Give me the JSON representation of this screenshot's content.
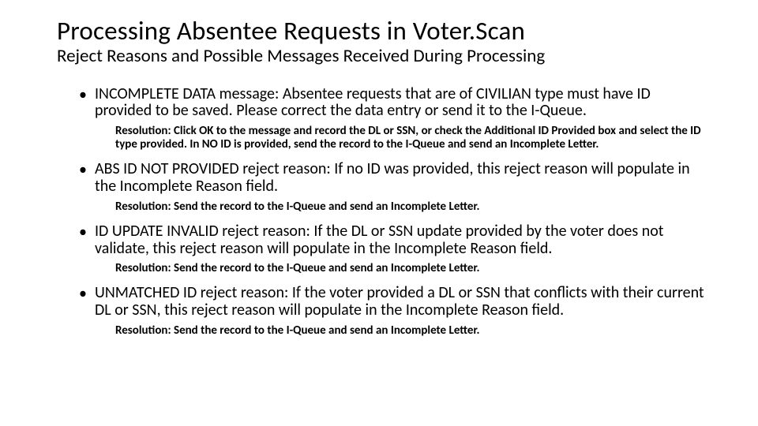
{
  "title": "Processing Absentee Requests in Voter.Scan",
  "subtitle": "Reject Reasons and Possible Messages Received During Processing",
  "items": [
    {
      "text": "INCOMPLETE DATA message: Absentee requests that are of CIVILIAN type must have ID provided to be saved.  Please correct the data entry or send it to the I-Queue.",
      "resolution": "Resolution: Click OK to the message and record the DL or SSN, or check the Additional ID Provided box and select the ID type provided. In NO ID is provided, send the record to the I-Queue and send an Incomplete Letter."
    },
    {
      "text": "ABS ID NOT PROVIDED reject reason: If no ID was provided, this reject reason will populate in the Incomplete Reason field.",
      "resolution": "Resolution: Send the record to the I-Queue and send an Incomplete Letter."
    },
    {
      "text": "ID UPDATE INVALID reject reason: If the DL or SSN update provided by the voter does not validate, this reject reason will populate in the Incomplete Reason field.",
      "resolution": "Resolution: Send the record to the I-Queue and send an Incomplete Letter."
    },
    {
      "text": "UNMATCHED ID reject reason: If the voter provided a DL or SSN that conflicts with their current DL or SSN, this reject reason will populate in the Incomplete Reason field.",
      "resolution": "Resolution: Send the record to the I-Queue and send an Incomplete Letter."
    }
  ]
}
